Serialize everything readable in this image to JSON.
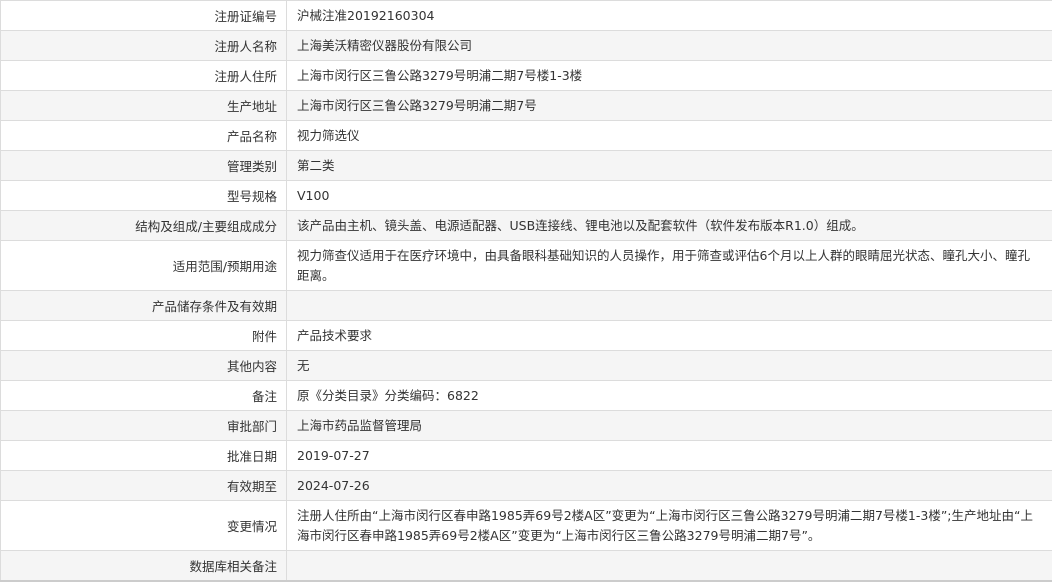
{
  "rows": [
    {
      "label": "注册证编号",
      "value": "沪械注准20192160304"
    },
    {
      "label": "注册人名称",
      "value": "上海美沃精密仪器股份有限公司"
    },
    {
      "label": "注册人住所",
      "value": "上海市闵行区三鲁公路3279号明浦二期7号楼1-3楼"
    },
    {
      "label": "生产地址",
      "value": "上海市闵行区三鲁公路3279号明浦二期7号"
    },
    {
      "label": "产品名称",
      "value": "视力筛选仪"
    },
    {
      "label": "管理类别",
      "value": "第二类"
    },
    {
      "label": "型号规格",
      "value": "V100"
    },
    {
      "label": "结构及组成/主要组成成分",
      "value": "该产品由主机、镜头盖、电源适配器、USB连接线、锂电池以及配套软件（软件发布版本R1.0）组成。"
    },
    {
      "label": "适用范围/预期用途",
      "value": "视力筛查仪适用于在医疗环境中，由具备眼科基础知识的人员操作，用于筛查或评估6个月以上人群的眼睛屈光状态、瞳孔大小、瞳孔距离。"
    },
    {
      "label": "产品储存条件及有效期",
      "value": ""
    },
    {
      "label": "附件",
      "value": "产品技术要求"
    },
    {
      "label": "其他内容",
      "value": "无"
    },
    {
      "label": "备注",
      "value": "原《分类目录》分类编码：6822"
    },
    {
      "label": "审批部门",
      "value": "上海市药品监督管理局"
    },
    {
      "label": "批准日期",
      "value": "2019-07-27"
    },
    {
      "label": "有效期至",
      "value": "2024-07-26"
    },
    {
      "label": "变更情况",
      "value": "注册人住所由“上海市闵行区春申路1985弄69号2楼A区”变更为“上海市闵行区三鲁公路3279号明浦二期7号楼1-3楼”;生产地址由“上海市闵行区春申路1985弄69号2楼A区”变更为“上海市闵行区三鲁公路3279号明浦二期7号”。"
    },
    {
      "label": "数据库相关备注",
      "value": ""
    }
  ]
}
